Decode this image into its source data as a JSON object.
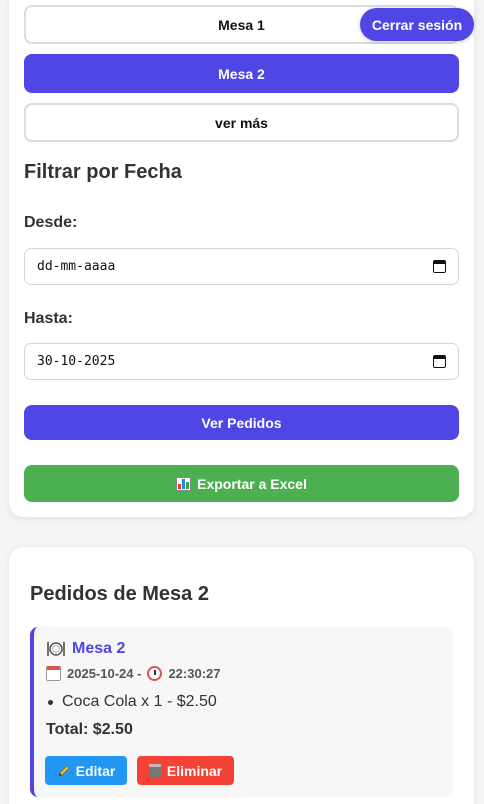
{
  "mesas": {
    "items": [
      {
        "label": "Mesa 1",
        "active": false
      },
      {
        "label": "Mesa 2",
        "active": true
      },
      {
        "label": "ver más",
        "active": false
      }
    ]
  },
  "header": {
    "logout_label": "Cerrar sesión"
  },
  "filter": {
    "title": "Filtrar por Fecha",
    "desde_label": "Desde:",
    "desde_value": "dd-mm-aaaa",
    "hasta_label": "Hasta:",
    "hasta_value": "30-10-2025",
    "ver_label": "Ver Pedidos",
    "export_label": "Exportar a Excel"
  },
  "pedidos": {
    "title": "Pedidos de Mesa 2",
    "orders": [
      {
        "mesa": "Mesa 2",
        "date": "2025-10-24 -",
        "time": "22:30:27",
        "items": [
          "Coca Cola x 1 - $2.50"
        ],
        "total": "Total: $2.50",
        "edit_label": "Editar",
        "delete_label": "Eliminar"
      }
    ]
  },
  "colors": {
    "primary": "#4f46e5",
    "success": "#4caf50",
    "info": "#2196f3",
    "danger": "#f44336"
  }
}
